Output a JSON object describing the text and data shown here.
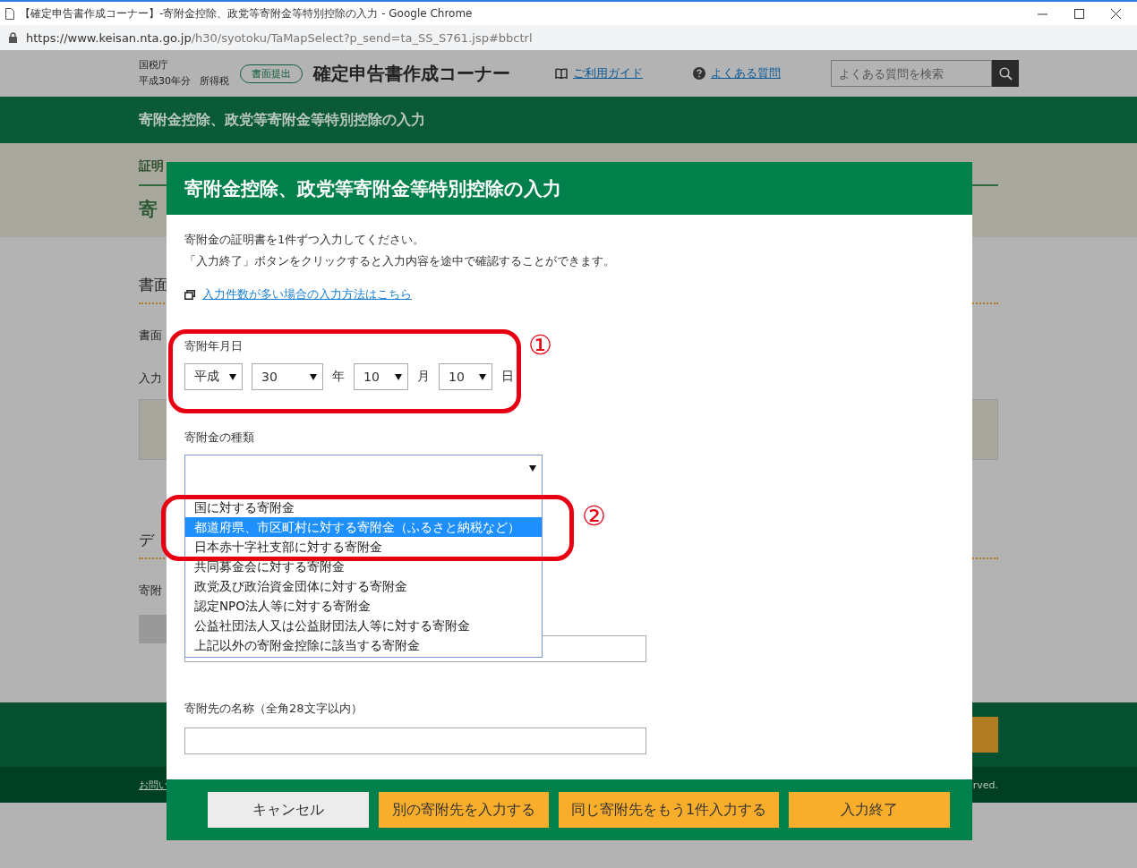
{
  "browser": {
    "title": "【確定申告書作成コーナー】-寄附金控除、政党等寄附金等特別控除の入力 - Google Chrome",
    "url_host": "https://www.keisan.nta.go.jp",
    "url_path": "/h30/syotoku/TaMapSelect?p_send=ta_SS_S761.jsp#bbctrl"
  },
  "site_header": {
    "agency": "国税庁",
    "year_tax": [
      "平成30年分",
      "所得税"
    ],
    "mode_badge": "書面提出",
    "title": "確定申告書作成コーナー",
    "guide_link": "ご利用ガイド",
    "faq_link": "よくある質問",
    "search": {
      "placeholder": "よくある質問を検索"
    }
  },
  "page_title": "寄附金控除、政党等寄附金等特別控除の入力",
  "behind_modal": {
    "tab": "証明",
    "section_title": "寄",
    "items": [
      {
        "kind": "heading",
        "text": "書面"
      },
      {
        "kind": "text",
        "text": "書面"
      },
      {
        "kind": "text",
        "text": "入力"
      },
      {
        "kind": "box"
      },
      {
        "kind": "heading",
        "text": "デ"
      },
      {
        "kind": "text",
        "text": "寄附"
      },
      {
        "kind": "button"
      }
    ]
  },
  "page_footer": {
    "link": "お問い",
    "copyright": "rved."
  },
  "modal": {
    "title": "寄附金控除、政党等寄附金等特別控除の入力",
    "intro": [
      "寄附金の証明書を1件ずつ入力してください。",
      "「入力終了」ボタンをクリックすると入力内容を途中で確認することができます。"
    ],
    "help_link": "入力件数が多い場合の入力方法はこちら",
    "date": {
      "label": "寄附年月日",
      "parts": [
        {
          "value": "平成"
        },
        {
          "value": "30",
          "unit": "年"
        },
        {
          "value": "10",
          "unit": "月"
        },
        {
          "value": "10",
          "unit": "日"
        }
      ]
    },
    "type": {
      "label": "寄附金の種類",
      "options": [
        {
          "label": "国に対する寄附金",
          "selected": false
        },
        {
          "label": "都道府県、市区町村に対する寄附金（ふるさと納税など）",
          "selected": true
        },
        {
          "label": "日本赤十字社支部に対する寄附金",
          "selected": false
        },
        {
          "label": "共同募金会に対する寄附金",
          "selected": false
        },
        {
          "label": "政党及び政治資金団体に対する寄附金",
          "selected": false
        },
        {
          "label": "認定NPO法人等に対する寄附金",
          "selected": false
        },
        {
          "label": "公益社団法人又は公益財団法人等に対する寄附金",
          "selected": false
        },
        {
          "label": "上記以外の寄附金控除に該当する寄附金",
          "selected": false
        }
      ]
    },
    "name_field": {
      "label": "寄附先の名称（全角28文字以内）"
    },
    "buttons": [
      {
        "label": "キャンセル",
        "kind": "secondary"
      },
      {
        "label": "別の寄附先を入力する",
        "kind": "primary"
      },
      {
        "label": "同じ寄附先をもう1件入力する",
        "kind": "primary"
      },
      {
        "label": "入力終了",
        "kind": "primary"
      }
    ]
  },
  "annotations": [
    {
      "mark": "①"
    },
    {
      "mark": "②"
    }
  ]
}
